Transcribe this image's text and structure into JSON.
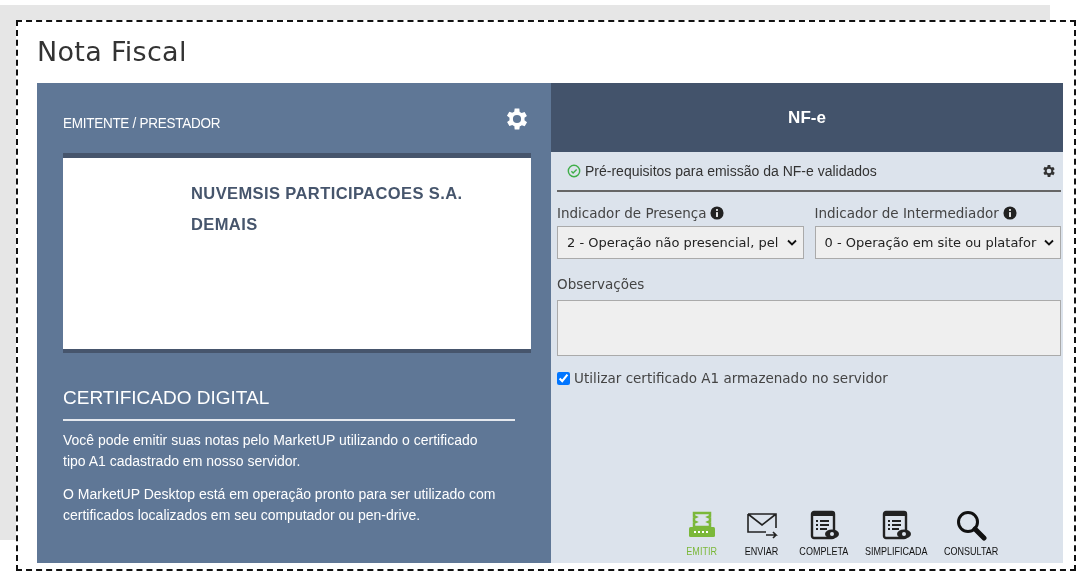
{
  "page": {
    "title": "Nota Fiscal"
  },
  "issuer": {
    "heading": "EMITENTE / PRESTADOR",
    "name": "NUVEMSIS PARTICIPACOES S.A.",
    "regime": "DEMAIS"
  },
  "certificate": {
    "heading": "CERTIFICADO DIGITAL",
    "paragraphs": [
      "Você pode emitir suas notas pelo MarketUP utilizando o certificado tipo A1 cadastrado em nosso servidor.",
      "O MarketUP Desktop está em operação pronto para ser utilizado com certificados localizados em seu computador ou pen-drive."
    ]
  },
  "nfe": {
    "title": "NF-e",
    "status": "Pré-requisitos para emissão da NF-e validados",
    "fields": [
      {
        "label": "Indicador de Presença",
        "value": "2 - Operação não presencial, pel"
      },
      {
        "label": "Indicador de Intermediador",
        "value": "0 - Operação em site ou platafor"
      }
    ],
    "notes": {
      "label": "Observações"
    },
    "use_server_certificate": {
      "label": "Utilizar certificado A1 armazenado no servidor",
      "checked": true
    },
    "actions": [
      {
        "kind": "issue",
        "label": "EMITIR",
        "active": true
      },
      {
        "kind": "send",
        "label": "ENVIAR",
        "active": false
      },
      {
        "kind": "document",
        "label": "COMPLETA",
        "active": false
      },
      {
        "kind": "document",
        "label": "SIMPLIFICADA",
        "active": false
      },
      {
        "kind": "search",
        "label": "CONSULTAR",
        "active": false
      }
    ]
  }
}
